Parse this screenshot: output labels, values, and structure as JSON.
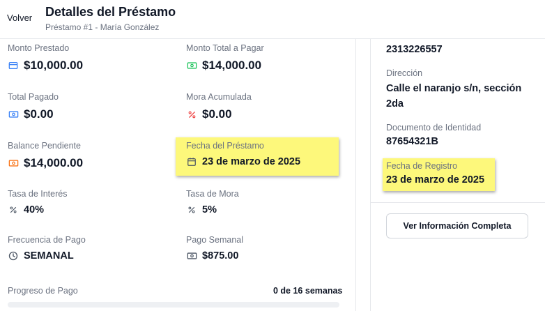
{
  "header": {
    "back_label": "Volver",
    "title": "Detalles del Préstamo",
    "subtitle": "Préstamo #1 - María González"
  },
  "loan": {
    "monto_prestado": {
      "label": "Monto Prestado",
      "value": "$10,000.00",
      "icon": "credit-card-icon"
    },
    "monto_total": {
      "label": "Monto Total a Pagar",
      "value": "$14,000.00",
      "icon": "banknote-icon"
    },
    "total_pagado": {
      "label": "Total Pagado",
      "value": "$0.00",
      "icon": "banknote-icon"
    },
    "mora_acumulada": {
      "label": "Mora Acumulada",
      "value": "$0.00",
      "icon": "percent-icon"
    },
    "balance_pendiente": {
      "label": "Balance Pendiente",
      "value": "$14,000.00",
      "icon": "banknote-icon"
    },
    "fecha_prestamo": {
      "label": "Fecha del Préstamo",
      "value": "23 de marzo de 2025",
      "icon": "calendar-icon"
    },
    "tasa_interes": {
      "label": "Tasa de Interés",
      "value": "40%",
      "icon": "percent-icon"
    },
    "tasa_mora": {
      "label": "Tasa de Mora",
      "value": "5%",
      "icon": "percent-icon"
    },
    "frecuencia": {
      "label": "Frecuencia de Pago",
      "value": "SEMANAL",
      "icon": "clock-icon"
    },
    "pago_semanal": {
      "label": "Pago Semanal",
      "value": "$875.00",
      "icon": "banknote-icon"
    }
  },
  "progress": {
    "label": "Progreso de Pago",
    "count_text": "0 de 16 semanas",
    "fraction": 0
  },
  "client": {
    "phone": "2313226557",
    "direccion_label": "Dirección",
    "direccion_value": "Calle el naranjo s/n, sección 2da",
    "documento_label": "Documento de Identidad",
    "documento_value": "87654321B",
    "registro_label": "Fecha de Registro",
    "registro_value": "23 de marzo de 2025",
    "button_label": "Ver Información Completa"
  },
  "colors": {
    "highlight": "#fdf87b",
    "blue_icon": "#3b82f6",
    "green_icon": "#22c55e",
    "orange_icon": "#f97316",
    "red_icon": "#ef4444",
    "gray_icon": "#4b5563"
  }
}
